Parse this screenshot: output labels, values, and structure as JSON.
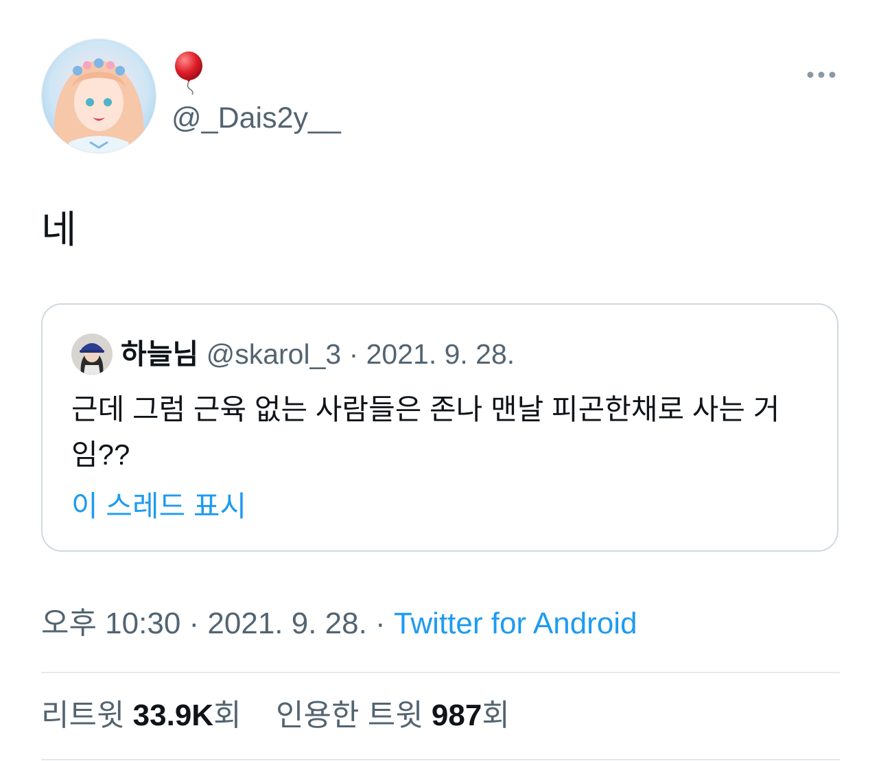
{
  "author": {
    "display_name": "🎈",
    "handle": "@_Dais2y__"
  },
  "tweet": {
    "text": "네"
  },
  "quoted": {
    "name": "하늘님",
    "handle": "@skarol_3",
    "separator": " · ",
    "date": "2021. 9. 28.",
    "text": "근데 그럼 근육 없는 사람들은 존나 맨날 피곤한채로 사는 거임??",
    "show_thread": "이 스레드 표시"
  },
  "meta": {
    "time": "오후 10:30",
    "separator": " · ",
    "date": "2021. 9. 28.",
    "separator2": " · ",
    "source": "Twitter for Android"
  },
  "stats": {
    "retweets_label": "리트윗 ",
    "retweets_count": "33.9K",
    "retweets_suffix": "회",
    "quotes_label": "인용한 트윗 ",
    "quotes_count": "987",
    "quotes_suffix": "회"
  },
  "icons": {
    "more": "more-horizontal-icon",
    "balloon": "red-balloon-emoji"
  },
  "colors": {
    "link": "#1d9bf0",
    "secondary_text": "#536471",
    "primary_text": "#0f1419",
    "border": "#cfd9de"
  }
}
